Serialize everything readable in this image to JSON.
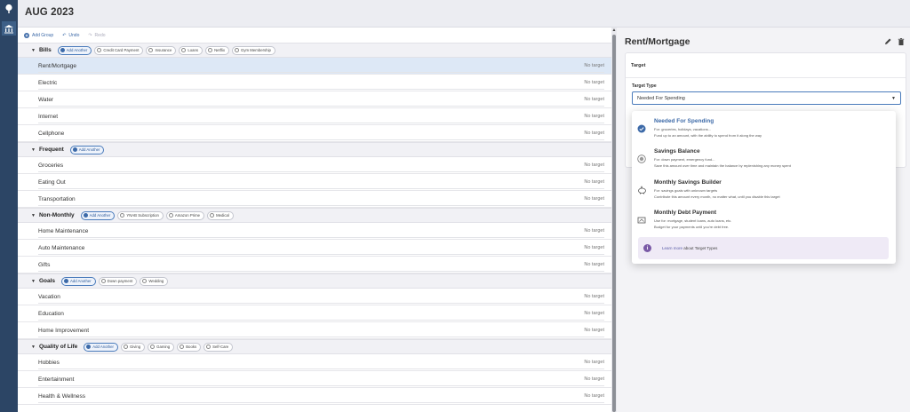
{
  "header": {
    "month": "AUG 2023"
  },
  "toolbar": {
    "add_group": "Add Group",
    "undo": "Undo",
    "redo": "Redo"
  },
  "no_target_label": "No target",
  "groups": [
    {
      "name": "Bills",
      "add": "Add Another",
      "suggestions": [
        "Credit Card Payment",
        "Insurance",
        "Loans",
        "Netflix",
        "Gym Membership"
      ],
      "categories": [
        "Rent/Mortgage",
        "Electric",
        "Water",
        "Internet",
        "Cellphone"
      ]
    },
    {
      "name": "Frequent",
      "add": "Add Another",
      "suggestions": [],
      "categories": [
        "Groceries",
        "Eating Out",
        "Transportation"
      ]
    },
    {
      "name": "Non-Monthly",
      "add": "Add Another",
      "suggestions": [
        "YNAB Subscription",
        "Amazon Prime",
        "Medical"
      ],
      "categories": [
        "Home Maintenance",
        "Auto Maintenance",
        "Gifts"
      ]
    },
    {
      "name": "Goals",
      "add": "Add Another",
      "suggestions": [
        "Down payment",
        "Wedding"
      ],
      "categories": [
        "Vacation",
        "Education",
        "Home Improvement"
      ]
    },
    {
      "name": "Quality of Life",
      "add": "Add Another",
      "suggestions": [
        "Giving",
        "Gaming",
        "Books",
        "Self-Care"
      ],
      "categories": [
        "Hobbies",
        "Entertainment",
        "Health & Wellness"
      ]
    }
  ],
  "detail": {
    "title": "Rent/Mortgage",
    "target_heading": "Target",
    "target_type_label": "Target Type",
    "selected_type": "Needed For Spending"
  },
  "dropdown": {
    "options": [
      {
        "name": "Needed For Spending",
        "for": "For: groceries, holidays, vacations...",
        "desc": "Fund up to an amount, with the ability to spend from it along the way",
        "icon": "check-circle-icon",
        "active": true
      },
      {
        "name": "Savings Balance",
        "for": "For: down payment, emergency fund...",
        "desc": "Save this amount over time and maintain the balance by replenishing any money spent",
        "icon": "target-circle-icon",
        "active": false
      },
      {
        "name": "Monthly Savings Builder",
        "for": "For: savings goals with unknown targets",
        "desc": "Contribute this amount every month, no matter what, until you disable this target",
        "icon": "piggy-bank-icon",
        "active": false
      },
      {
        "name": "Monthly Debt Payment",
        "for": "Use for: mortgage, student loans, auto loans, etc.",
        "desc": "Budget for your payments until you're debt free.",
        "icon": "debt-card-icon",
        "active": false
      }
    ],
    "learn_link": "Learn more",
    "learn_rest": " about Target Types"
  },
  "colors": {
    "sidebar": "#2c4565",
    "accent": "#3d6aa8",
    "selected_row": "#dde8f6",
    "info": "#7a5aa6"
  }
}
